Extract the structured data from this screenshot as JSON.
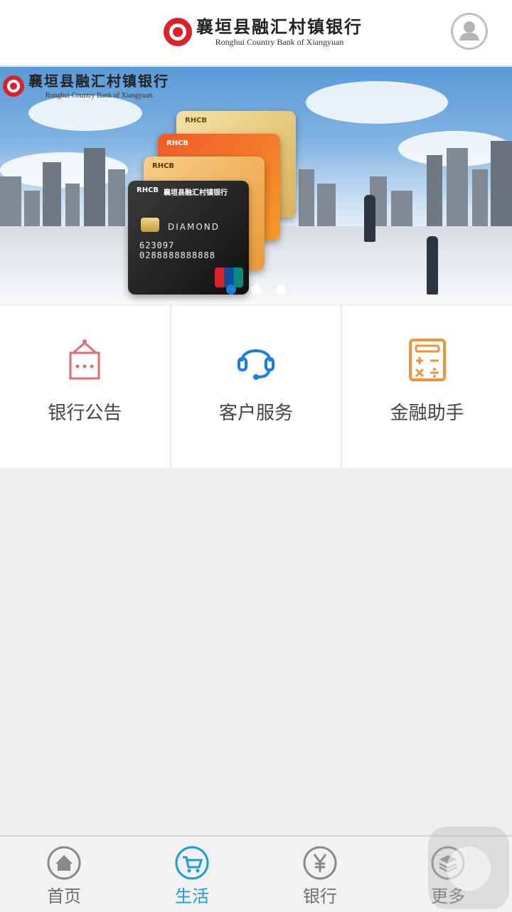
{
  "header": {
    "logo_cn": "襄垣县融汇村镇银行",
    "logo_en": "Ronghui Country Bank of Xiangyuan",
    "avatar_icon": "user-avatar-icon"
  },
  "banner": {
    "logo_cn": "襄垣县融汇村镇银行",
    "logo_en": "Ronghui Country Bank of Xiangyuan",
    "card_brand": "RHCB",
    "card_bank": "襄垣县融汇村镇银行",
    "card_tier": "DIAMOND",
    "card_number": "623097 0288888888888",
    "slides_count": 3,
    "active_slide": 1
  },
  "features": [
    {
      "label": "银行公告",
      "icon": "announcement-icon",
      "color": "#e86b6b"
    },
    {
      "label": "客户服务",
      "icon": "headset-icon",
      "color": "#1a7de0"
    },
    {
      "label": "金融助手",
      "icon": "calculator-icon",
      "color": "#f2923a"
    }
  ],
  "tabbar": {
    "items": [
      {
        "label": "首页",
        "icon": "home-icon"
      },
      {
        "label": "生活",
        "icon": "cart-icon"
      },
      {
        "label": "银行",
        "icon": "yuan-icon"
      },
      {
        "label": "更多",
        "icon": "layers-icon"
      }
    ],
    "active_index": 1,
    "active_color": "#1a9de0"
  }
}
